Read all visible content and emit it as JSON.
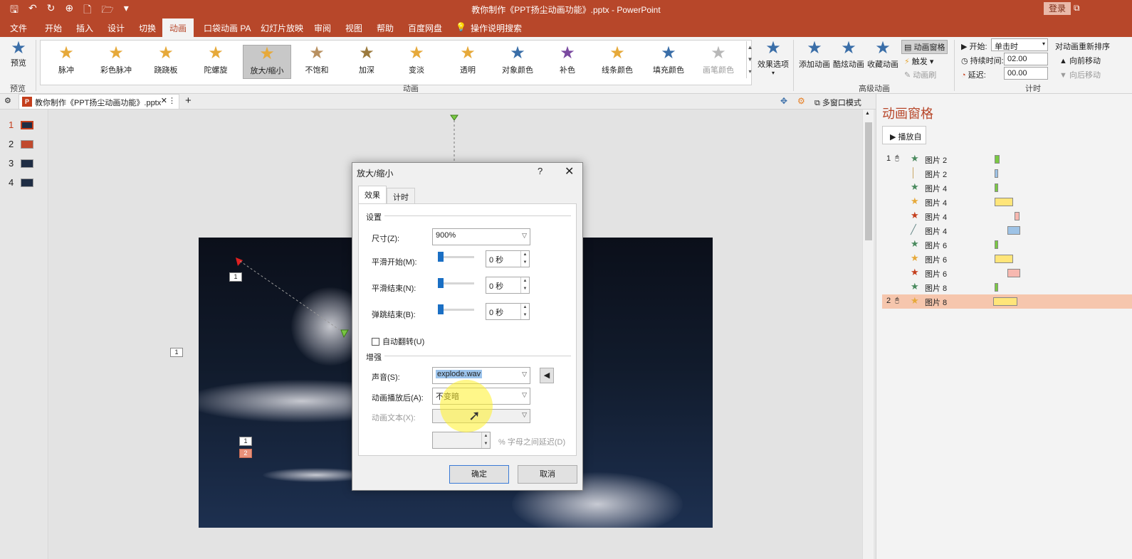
{
  "window": {
    "title": "教你制作《PPT扬尘动画功能》.pptx - PowerPoint",
    "login": "登录"
  },
  "menu_tabs": [
    "文件",
    "开始",
    "插入",
    "设计",
    "切换",
    "动画",
    "口袋动画 PA",
    "幻灯片放映",
    "审阅",
    "视图",
    "帮助",
    "百度网盘",
    "操作说明搜索"
  ],
  "active_tab": "动画",
  "ribbon": {
    "preview": {
      "label": "预览",
      "group": "预览"
    },
    "gallery": [
      {
        "label": "脉冲",
        "color": "#e6a93a"
      },
      {
        "label": "彩色脉冲",
        "color": "#e6a93a"
      },
      {
        "label": "跷跷板",
        "color": "#e6a93a"
      },
      {
        "label": "陀螺旋",
        "color": "#e6a93a"
      },
      {
        "label": "放大/缩小",
        "color": "#e6a93a"
      },
      {
        "label": "不饱和",
        "color": "#b89060"
      },
      {
        "label": "加深",
        "color": "#9b7a3d"
      },
      {
        "label": "变淡",
        "color": "#e6a93a"
      },
      {
        "label": "透明",
        "color": "#e6a93a"
      },
      {
        "label": "对象颜色",
        "color": "#3a6ea8"
      },
      {
        "label": "补色",
        "color": "#7a4aa0"
      },
      {
        "label": "线条颜色",
        "color": "#e6a93a"
      },
      {
        "label": "填充颜色",
        "color": "#3a6ea8"
      },
      {
        "label": "画笔颜色",
        "color": "#b8b8b8"
      }
    ],
    "gallery_selected": "放大/缩小",
    "effect_options": "效果选项",
    "group_animation": "动画",
    "advanced": {
      "add": "添加动画",
      "cool": "酷炫动画",
      "collect": "收藏动画",
      "pane": "动画窗格",
      "trigger": "触发",
      "painter": "动画刷",
      "group": "高级动画"
    },
    "timing": {
      "start_label": "开始:",
      "start_value": "单击时",
      "duration_label": "持续时间:",
      "duration_value": "02.00",
      "delay_label": "延迟:",
      "delay_value": "00.00",
      "reorder": "对动画重新排序",
      "earlier": "向前移动",
      "later": "向后移动",
      "group": "计时"
    }
  },
  "doc_tab": {
    "name": "教你制作《PPT扬尘动画功能》.pptx",
    "window_mode": "多窗口模式"
  },
  "thumbnails": [
    "1",
    "2",
    "3",
    "4"
  ],
  "slide_tags": [
    "1",
    "1",
    "1",
    "2"
  ],
  "anim_pane": {
    "title": "动画窗格",
    "play": "播放自",
    "rows": [
      {
        "num": "1",
        "icon": "green-star",
        "name": "图片 2",
        "color": "#7ac943"
      },
      {
        "num": "",
        "icon": "blue-line",
        "name": "图片 2",
        "color": "#9ec3e6"
      },
      {
        "num": "",
        "icon": "green-star",
        "name": "图片 4",
        "color": "#7ac943"
      },
      {
        "num": "",
        "icon": "gold-star",
        "name": "图片 4",
        "color": "#ffe57a"
      },
      {
        "num": "",
        "icon": "red-star",
        "name": "图片 4",
        "color": "#f7b8b0"
      },
      {
        "num": "",
        "icon": "path-line",
        "name": "图片 4",
        "color": "#9ec3e6"
      },
      {
        "num": "",
        "icon": "green-star",
        "name": "图片 6",
        "color": "#7ac943"
      },
      {
        "num": "",
        "icon": "gold-star",
        "name": "图片 6",
        "color": "#ffe57a"
      },
      {
        "num": "",
        "icon": "red-star",
        "name": "图片 6",
        "color": "#f7b8b0"
      },
      {
        "num": "",
        "icon": "green-star",
        "name": "图片 8",
        "color": "#7ac943"
      },
      {
        "num": "2",
        "icon": "gold-star",
        "name": "图片 8",
        "color": "#ffe57a"
      }
    ]
  },
  "dialog": {
    "title": "放大/缩小",
    "help": "?",
    "tabs": [
      "效果",
      "计时"
    ],
    "section_settings": "设置",
    "size_label": "尺寸(Z):",
    "size_value": "900%",
    "smooth_start_label": "平滑开始(M):",
    "smooth_start_value": "0 秒",
    "smooth_end_label": "平滑结束(N):",
    "smooth_end_value": "0 秒",
    "bounce_end_label": "弹跳结束(B):",
    "bounce_end_value": "0 秒",
    "auto_reverse": "自动翻转(U)",
    "section_enhance": "增强",
    "sound_label": "声音(S):",
    "sound_value": "explode.wav",
    "after_label": "动画播放后(A):",
    "after_value": "不变暗",
    "text_label": "动画文本(X):",
    "text_value": "",
    "letter_delay": "% 字母之间延迟(D)",
    "ok": "确定",
    "cancel": "取消"
  }
}
